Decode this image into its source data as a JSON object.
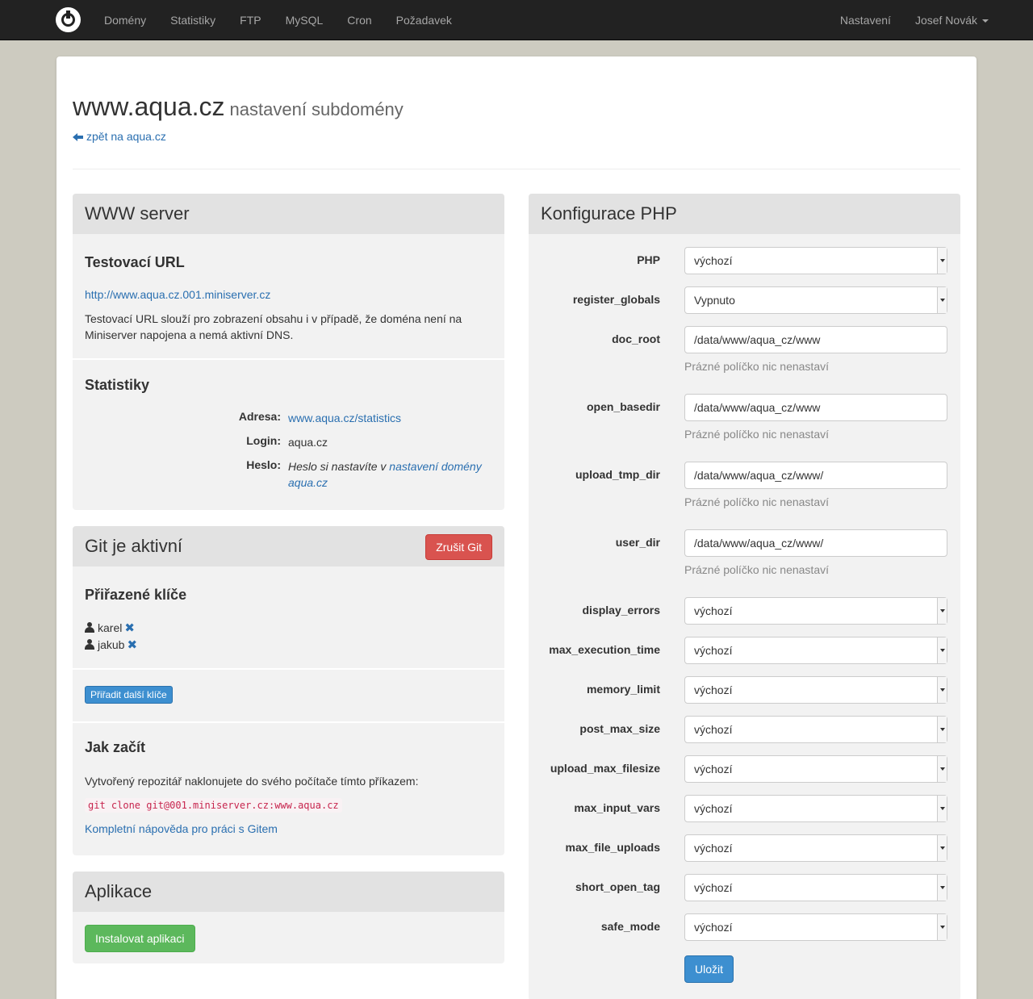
{
  "nav": {
    "items": [
      "Domény",
      "Statistiky",
      "FTP",
      "MySQL",
      "Cron",
      "Požadavek"
    ],
    "settings": "Nastavení",
    "user": "Josef Novák"
  },
  "header": {
    "title": "www.aqua.cz",
    "subtitle": "nastavení subdomény",
    "back_link": "zpět na aqua.cz"
  },
  "www_server": {
    "title": "WWW server",
    "test_url": {
      "heading": "Testovací URL",
      "url": "http://www.aqua.cz.001.miniserver.cz",
      "description": "Testovací URL slouží pro zobrazení obsahu i v případě, že doména není na Miniserver napojena a nemá aktivní DNS."
    },
    "stats": {
      "heading": "Statistiky",
      "address_label": "Adresa:",
      "address_value": "www.aqua.cz/statistics",
      "login_label": "Login:",
      "login_value": "aqua.cz",
      "password_label": "Heslo:",
      "password_text": "Heslo si nastavíte v ",
      "password_link": "nastavení domény aqua.cz"
    }
  },
  "git": {
    "title": "Git je aktivní",
    "cancel_button": "Zrušit Git",
    "keys_heading": "Přiřazené klíče",
    "keys": [
      "karel",
      "jakub"
    ],
    "remove_symbol": "✖",
    "add_keys_button": "Přiřadit další klíče",
    "start_heading": "Jak začít",
    "start_text": "Vytvořený repozitář naklonujete do svého počítače tímto příkazem:",
    "clone_command": "git clone git@001.miniserver.cz:www.aqua.cz",
    "help_link": "Kompletní nápověda pro práci s Gitem"
  },
  "apps": {
    "title": "Aplikace",
    "install_button": "Instalovat aplikaci"
  },
  "php": {
    "title": "Konfigurace PHP",
    "help_text": "Prázné políčko nic nenastaví",
    "save_button": "Uložit",
    "fields": [
      {
        "label": "PHP",
        "value": "výchozí",
        "type": "select"
      },
      {
        "label": "register_globals",
        "value": "Vypnuto",
        "type": "select"
      },
      {
        "label": "doc_root",
        "value": "/data/www/aqua_cz/www",
        "type": "text"
      },
      {
        "label": "open_basedir",
        "value": "/data/www/aqua_cz/www",
        "type": "text"
      },
      {
        "label": "upload_tmp_dir",
        "value": "/data/www/aqua_cz/www/",
        "type": "text"
      },
      {
        "label": "user_dir",
        "value": "/data/www/aqua_cz/www/",
        "type": "text"
      },
      {
        "label": "display_errors",
        "value": "výchozí",
        "type": "select"
      },
      {
        "label": "max_execution_time",
        "value": "výchozí",
        "type": "select"
      },
      {
        "label": "memory_limit",
        "value": "výchozí",
        "type": "select"
      },
      {
        "label": "post_max_size",
        "value": "výchozí",
        "type": "select"
      },
      {
        "label": "upload_max_filesize",
        "value": "výchozí",
        "type": "select"
      },
      {
        "label": "max_input_vars",
        "value": "výchozí",
        "type": "select"
      },
      {
        "label": "max_file_uploads",
        "value": "výchozí",
        "type": "select"
      },
      {
        "label": "short_open_tag",
        "value": "výchozí",
        "type": "select"
      },
      {
        "label": "safe_mode",
        "value": "výchozí",
        "type": "select"
      }
    ]
  }
}
